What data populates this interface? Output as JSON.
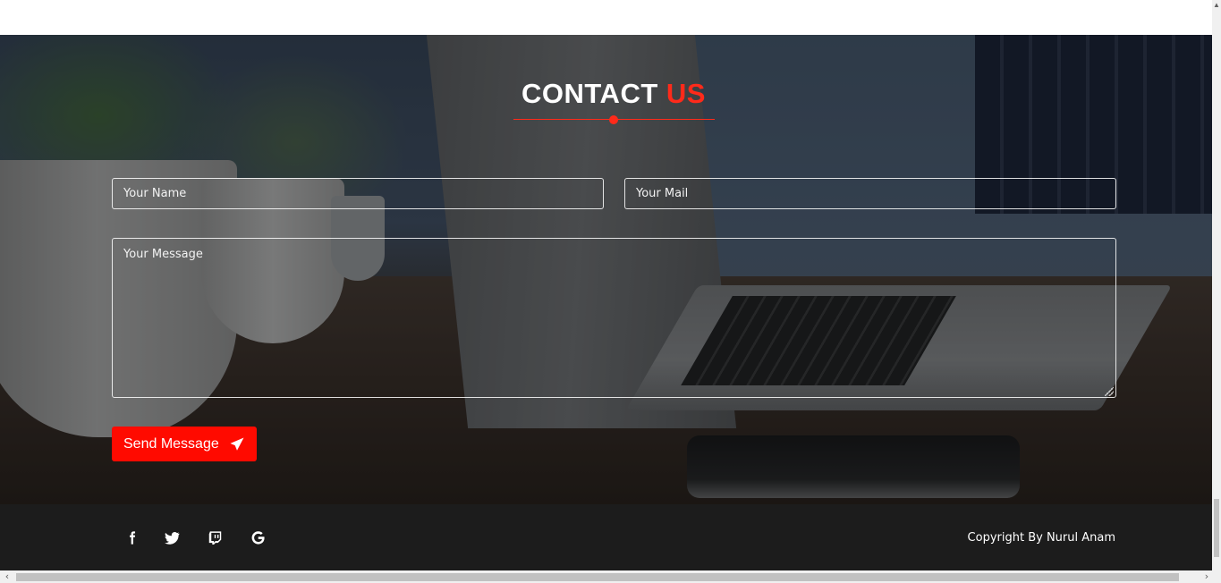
{
  "contact": {
    "title_main": "CONTACT",
    "title_accent": "US",
    "accent_color": "#ff2a1a",
    "name_placeholder": "Your Name",
    "mail_placeholder": "Your Mail",
    "message_placeholder": "Your Message",
    "send_label": "Send Message",
    "send_icon": "paper-plane-icon",
    "button_color": "#ff0a00"
  },
  "footer": {
    "background": "#1c1c1c",
    "social": [
      {
        "icon": "facebook-icon"
      },
      {
        "icon": "twitter-icon"
      },
      {
        "icon": "twitch-icon"
      },
      {
        "icon": "google-icon"
      }
    ],
    "copyright": "Copyright By Nurul Anam"
  }
}
